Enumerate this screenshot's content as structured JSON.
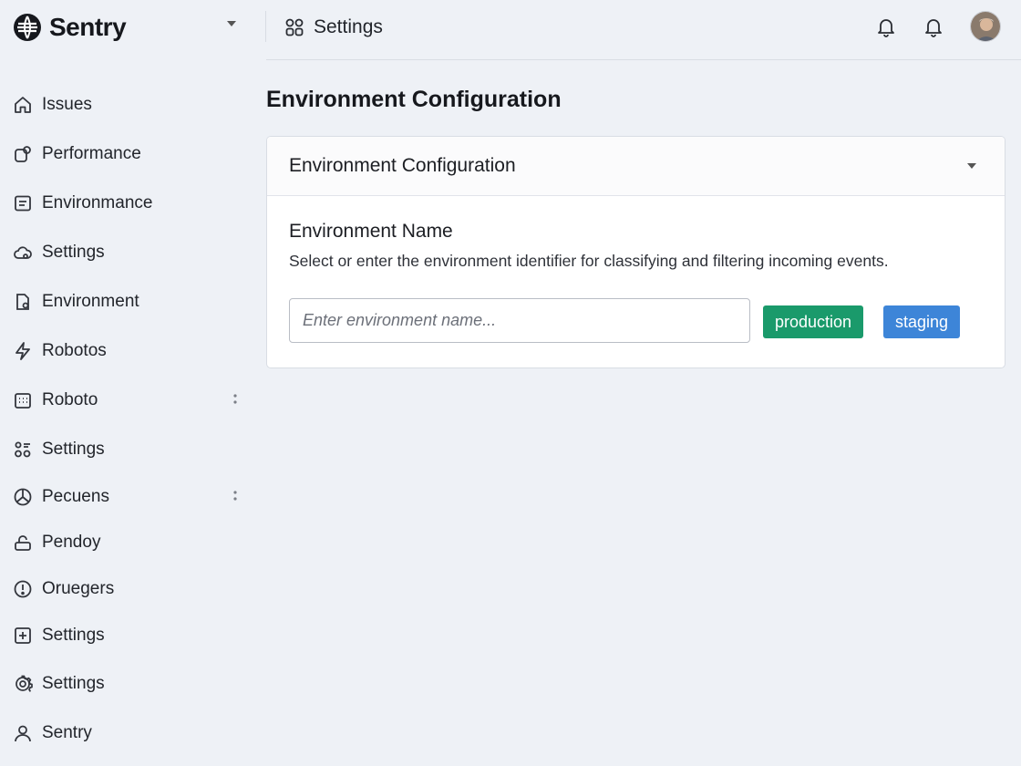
{
  "app": {
    "brand_name": "Sentry",
    "brand_icon": "sentry-logo-icon"
  },
  "topbar": {
    "title": "Settings",
    "title_icon": "grid-icon",
    "actions": [
      {
        "icon": "bell-icon"
      },
      {
        "icon": "bell-icon"
      },
      {
        "icon": "avatar"
      }
    ]
  },
  "sidebar": {
    "items": [
      {
        "label": "Issues",
        "icon": "home-icon"
      },
      {
        "label": "Performance",
        "icon": "performance-icon"
      },
      {
        "label": "Environmance",
        "icon": "list-icon"
      },
      {
        "label": "Settings",
        "icon": "cloud-icon"
      },
      {
        "label": "Environment",
        "icon": "document-icon"
      },
      {
        "label": "Robotos",
        "icon": "lightning-icon"
      },
      {
        "label": "Roboto",
        "icon": "calendar-icon",
        "has_more": true
      },
      {
        "label": "Settings",
        "icon": "apps-icon"
      },
      {
        "label": "Pecuens",
        "icon": "circle-icon",
        "has_more": true
      },
      {
        "label": "Pendoy",
        "icon": "lock-icon"
      },
      {
        "label": "Oruegers",
        "icon": "alert-icon"
      },
      {
        "label": "Settings",
        "icon": "plus-box-icon"
      },
      {
        "label": "Settings",
        "icon": "gear-icon"
      },
      {
        "label": "Sentry",
        "icon": "user-icon"
      }
    ]
  },
  "main": {
    "page_title": "Environment Configuration",
    "panel": {
      "title": "Environment Configuration",
      "field_label": "Environment Name",
      "field_help": "Select or enter the environment identifier for classifying and filtering incoming events.",
      "input_value": "",
      "input_placeholder": "Enter environment name...",
      "tags": [
        "production",
        "staging"
      ]
    }
  },
  "colors": {
    "background": "#eef1f6",
    "tag_production": "#1a9a6b",
    "tag_staging": "#3d85d8"
  }
}
